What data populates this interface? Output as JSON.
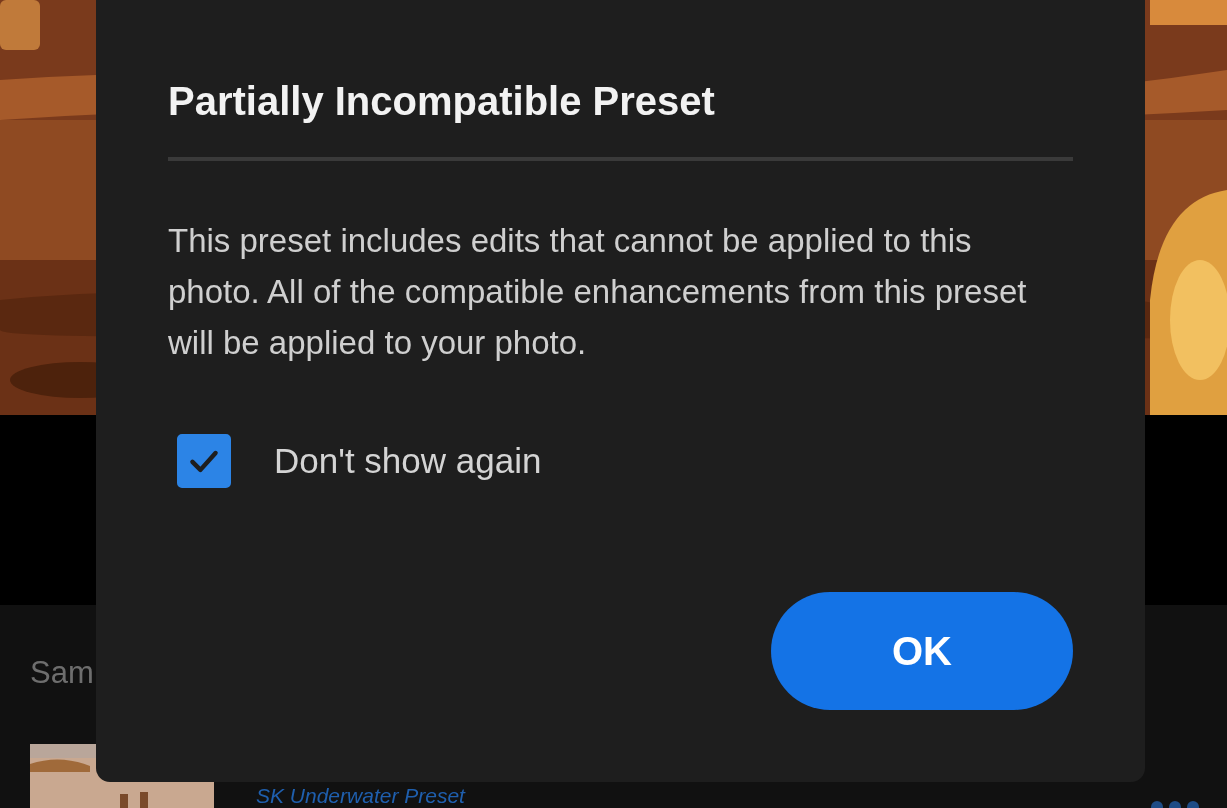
{
  "background": {
    "section_title": "Sam",
    "preset": {
      "name": "SK Underwater Preset"
    }
  },
  "dialog": {
    "title": "Partially Incompatible Preset",
    "message": "This preset includes edits that cannot be applied to this photo. All of the compatible enhancements from this preset will be applied to your photo.",
    "checkbox": {
      "label": "Don't show again",
      "checked": true
    },
    "buttons": [
      {
        "label": "OK",
        "kind": "primary"
      }
    ]
  }
}
